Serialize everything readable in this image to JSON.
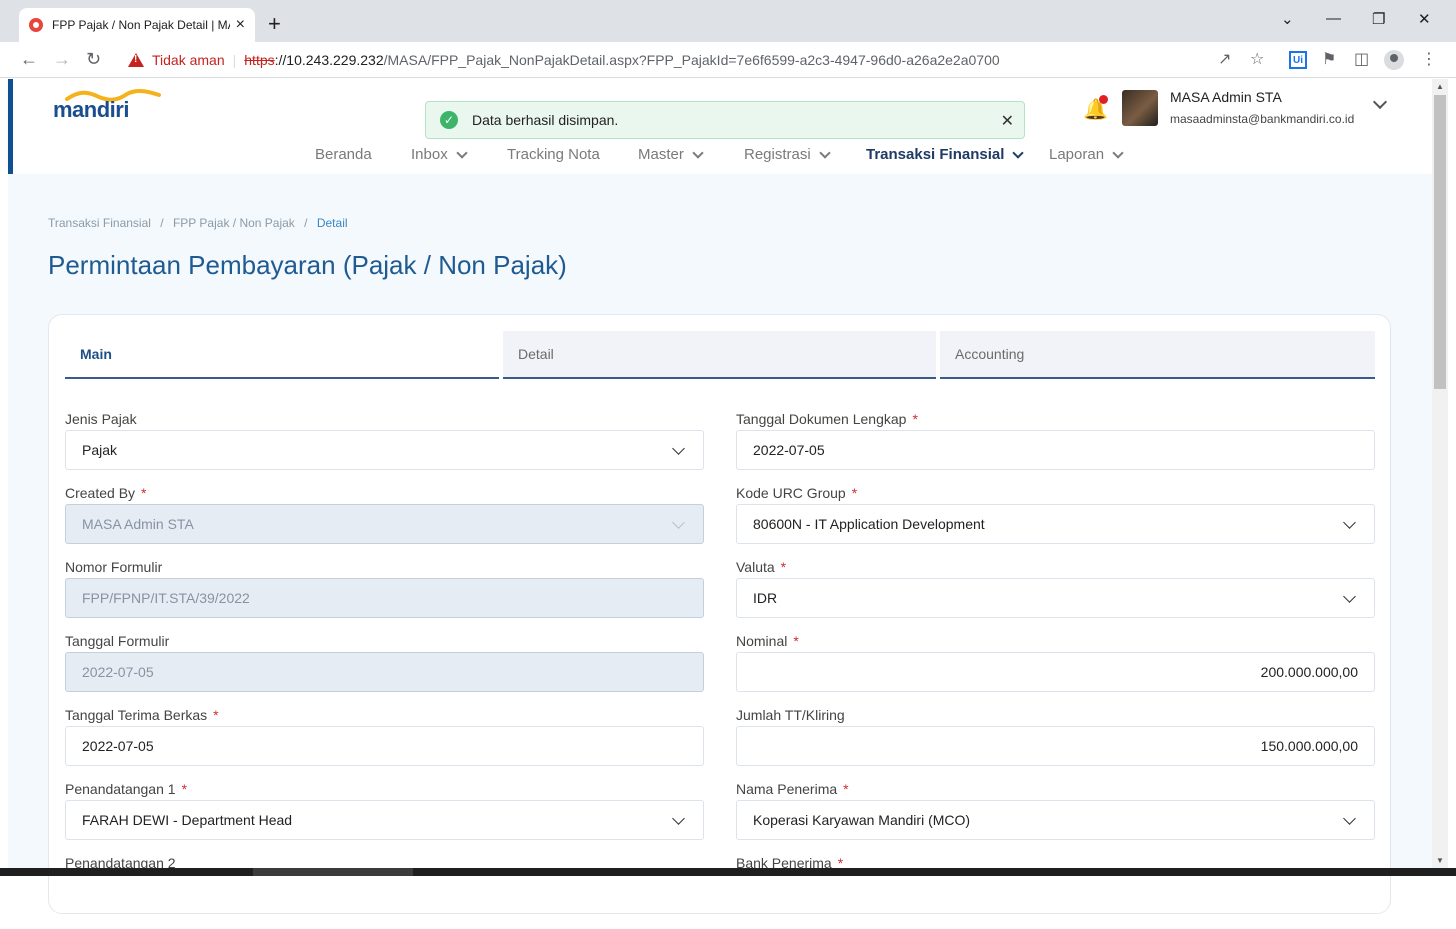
{
  "browser": {
    "tab_title": "FPP Pajak / Non Pajak Detail | MA",
    "tab_close": "×",
    "new_tab": "+",
    "security_label": "Tidak aman",
    "url_scheme": "https",
    "url_host": "://10.243.229.232",
    "url_path": "/MASA/FPP_Pajak_NonPajakDetail.aspx?FPP_PajakId=7e6f6599-a2c3-4947-96d0-a26a2e2a0700",
    "ext_label": "Ui"
  },
  "header": {
    "logo_text": "mandiri",
    "toast_message": "Data berhasil disimpan.",
    "user_name": "MASA Admin STA",
    "user_email": "masaadminsta@bankmandiri.co.id",
    "nav": [
      {
        "label": "Beranda"
      },
      {
        "label": "Inbox"
      },
      {
        "label": "Tracking Nota"
      },
      {
        "label": "Master"
      },
      {
        "label": "Registrasi"
      },
      {
        "label": "Transaksi Finansial"
      },
      {
        "label": "Laporan"
      }
    ]
  },
  "page": {
    "breadcrumb": [
      "Transaksi Finansial",
      "FPP Pajak / Non Pajak",
      "Detail"
    ],
    "breadcrumb_sep": "/",
    "title": "Permintaan Pembayaran (Pajak / Non Pajak)",
    "tabs": [
      "Main",
      "Detail",
      "Accounting"
    ],
    "required_mark": "*",
    "left_fields": [
      {
        "label": "Jenis Pajak",
        "value": "Pajak"
      },
      {
        "label": "Created By",
        "value": "MASA Admin STA"
      },
      {
        "label": "Nomor Formulir",
        "value": "FPP/FPNP/IT.STA/39/2022"
      },
      {
        "label": "Tanggal Formulir",
        "value": "2022-07-05"
      },
      {
        "label": "Tanggal Terima Berkas",
        "value": "2022-07-05"
      },
      {
        "label": "Penandatangan 1",
        "value": "FARAH DEWI - Department Head"
      },
      {
        "label": "Penandatangan 2",
        "value": ""
      }
    ],
    "right_fields": [
      {
        "label": "Tanggal Dokumen Lengkap",
        "value": "2022-07-05"
      },
      {
        "label": "Kode URC Group",
        "value": "80600N - IT Application Development"
      },
      {
        "label": "Valuta",
        "value": "IDR"
      },
      {
        "label": "Nominal",
        "value": "200.000.000,00"
      },
      {
        "label": "Jumlah TT/Kliring",
        "value": "150.000.000,00"
      },
      {
        "label": "Nama Penerima",
        "value": "Koperasi Karyawan Mandiri (MCO)"
      },
      {
        "label": "Bank Penerima",
        "value": ""
      }
    ]
  },
  "colors": {
    "brand": "#1a4e8e",
    "title": "#1f5a93",
    "success": "#3cb56a",
    "required": "#d12d2d"
  }
}
